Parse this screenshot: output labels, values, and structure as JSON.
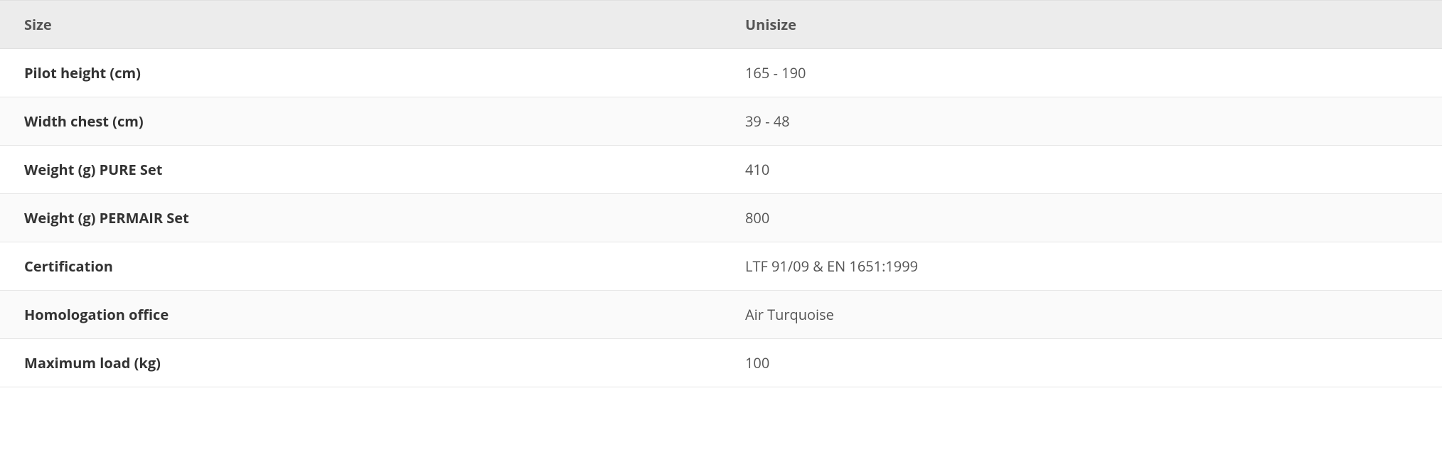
{
  "table": {
    "header": {
      "label": "Size",
      "value": "Unisize"
    },
    "rows": [
      {
        "label": "Pilot height (cm)",
        "value": "165 - 190"
      },
      {
        "label": "Width chest (cm)",
        "value": "39 - 48"
      },
      {
        "label": "Weight (g) PURE Set",
        "value": "410"
      },
      {
        "label": "Weight (g) PERMAIR Set",
        "value": "800"
      },
      {
        "label": "Certification",
        "value": "LTF 91/09 & EN 1651:1999"
      },
      {
        "label": "Homologation office",
        "value": "Air Turquoise"
      },
      {
        "label": "Maximum load (kg)",
        "value": "100"
      }
    ]
  }
}
